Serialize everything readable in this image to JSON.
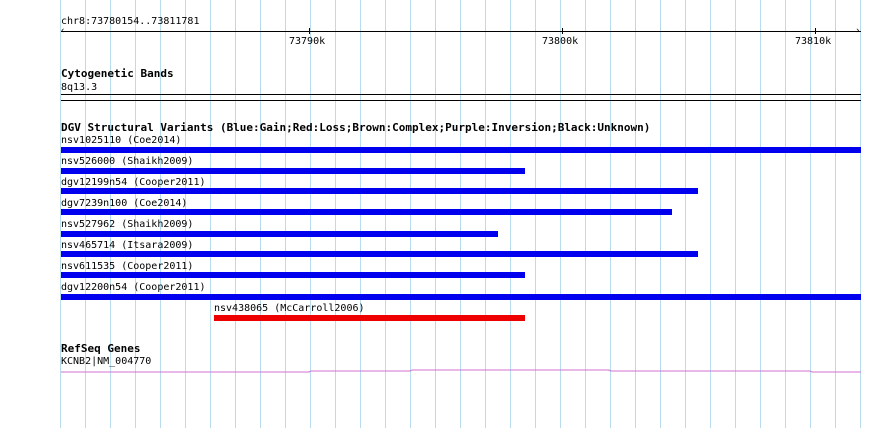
{
  "colors": {
    "gain": "#0000ee",
    "loss": "#ee0000",
    "gene_line": "#d070d0",
    "grid": "#b8dcec"
  },
  "ruler": {
    "region_label": "chr8:73780154..73811781",
    "ticks": [
      "73790k",
      "73800k",
      "73810k"
    ]
  },
  "cyto": {
    "title": "Cytogenetic Bands",
    "band": "8q13.3"
  },
  "dgv": {
    "title": "DGV Structural Variants (Blue:Gain;Red:Loss;Brown:Complex;Purple:Inversion;Black:Unknown)",
    "variants": [
      {
        "label": "nsv1025110 (Coe2014)",
        "type": "gain"
      },
      {
        "label": "nsv526000 (Shaikh2009)",
        "type": "gain"
      },
      {
        "label": "dgv12199n54 (Cooper2011)",
        "type": "gain"
      },
      {
        "label": "dgv7239n100 (Coe2014)",
        "type": "gain"
      },
      {
        "label": "nsv527962 (Shaikh2009)",
        "type": "gain"
      },
      {
        "label": "nsv465714 (Itsara2009)",
        "type": "gain"
      },
      {
        "label": "nsv611535 (Cooper2011)",
        "type": "gain"
      },
      {
        "label": "dgv12200n54 (Cooper2011)",
        "type": "gain"
      },
      {
        "label": "nsv438065 (McCarroll2006)",
        "type": "loss"
      }
    ]
  },
  "refseq": {
    "title": "RefSeq Genes",
    "gene": "KCNB2|NM_004770"
  }
}
